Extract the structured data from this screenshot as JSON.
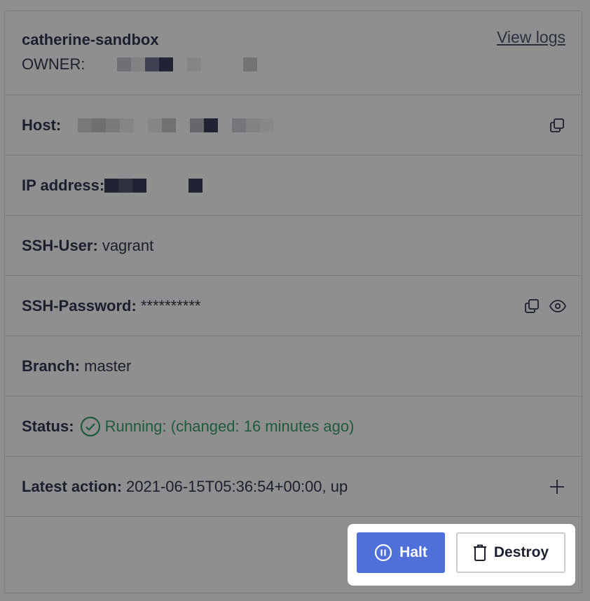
{
  "sandbox": {
    "name": "catherine-sandbox",
    "owner_label": "OWNER:",
    "view_logs_label": "View logs"
  },
  "fields": {
    "host_label": "Host:",
    "ip_label": "IP address:",
    "ssh_user_label": "SSH-User:",
    "ssh_user_value": "vagrant",
    "ssh_password_label": "SSH-Password:",
    "ssh_password_value": "**********",
    "branch_label": "Branch:",
    "branch_value": "master",
    "status_label": "Status:",
    "status_value": "Running: (changed: 16 minutes ago)",
    "latest_action_label": "Latest action:",
    "latest_action_value": "2021-06-15T05:36:54+00:00, up"
  },
  "actions": {
    "halt_label": "Halt",
    "destroy_label": "Destroy"
  },
  "colors": {
    "overlay": "#8e8e8e",
    "status_green": "#1f5a3b",
    "halt_blue": "#4f6fd9"
  },
  "icons": {
    "copy": "copy-icon",
    "eye": "eye-icon",
    "plus": "plus-icon",
    "status": "check-circle-icon",
    "pause": "pause-circle-icon",
    "trash": "trash-icon"
  }
}
